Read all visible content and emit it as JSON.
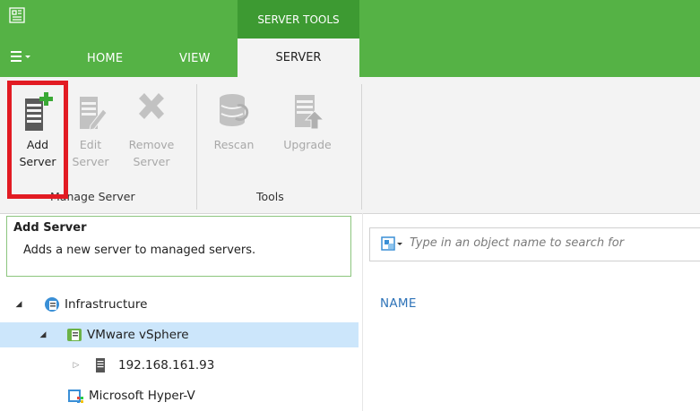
{
  "header": {
    "app_icon": "veeam-logo-icon",
    "context_tab": "SERVER TOOLS",
    "menu_button": "≡▾",
    "tabs": [
      {
        "label": "HOME"
      },
      {
        "label": "VIEW"
      },
      {
        "label": "SERVER",
        "active": true
      }
    ]
  },
  "ribbon": {
    "groups": [
      {
        "label": "Manage Server",
        "buttons": [
          {
            "line1": "Add",
            "line2": "Server",
            "icon": "add-server-icon",
            "enabled": true
          },
          {
            "line1": "Edit",
            "line2": "Server",
            "icon": "edit-server-icon",
            "enabled": false
          },
          {
            "line1": "Remove",
            "line2": "Server",
            "icon": "remove-server-icon",
            "enabled": false
          }
        ]
      },
      {
        "label": "Tools",
        "buttons": [
          {
            "line1": "Rescan",
            "line2": "",
            "icon": "rescan-icon",
            "enabled": false
          },
          {
            "line1": "Upgrade",
            "line2": "",
            "icon": "upgrade-icon",
            "enabled": false
          }
        ]
      }
    ],
    "highlight_color": "#e21b23"
  },
  "tooltip": {
    "title": "Add Server",
    "description": "Adds a new server to managed servers."
  },
  "tree": [
    {
      "label": "Infrastructure",
      "icon": "infrastructure-icon",
      "expanded": true,
      "selected": false
    },
    {
      "label": "VMware vSphere",
      "icon": "vsphere-icon",
      "expanded": true,
      "selected": true
    },
    {
      "label": "192.168.161.93",
      "icon": "server-icon",
      "expanded": false,
      "selected": false
    },
    {
      "label": "Microsoft Hyper-V",
      "icon": "hyperv-icon",
      "expanded": false,
      "selected": false
    }
  ],
  "search": {
    "placeholder": "Type in an object name to search for"
  },
  "table": {
    "columns": [
      "NAME"
    ]
  },
  "colors": {
    "brand_green": "#55b245",
    "context_green": "#3d9a32",
    "selection": "#cce6fb",
    "header_blue": "#2e73b8"
  }
}
